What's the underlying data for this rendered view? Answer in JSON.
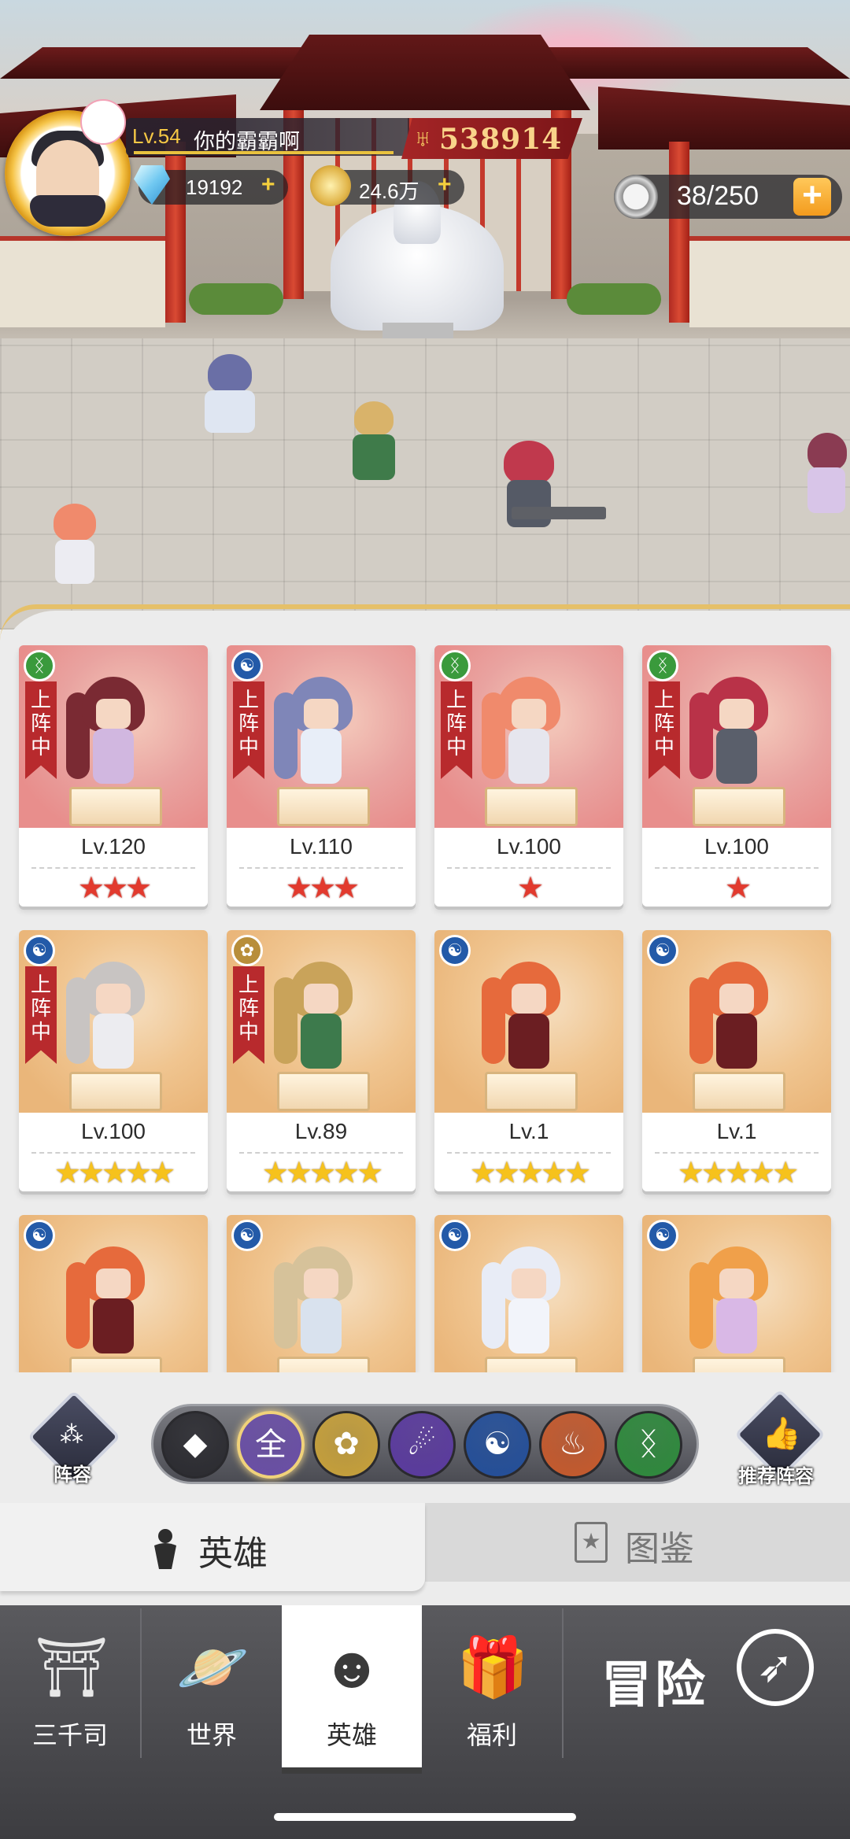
{
  "player": {
    "level": "Lv.54",
    "name": "你的霸霸啊",
    "power": "538914"
  },
  "resources": {
    "gems": "19192",
    "coins": "24.6万",
    "stamina": "38/250",
    "gem_icon": "diamond-icon",
    "coin_icon": "gold-coin-icon",
    "stamina_icon": "stamina-token-icon"
  },
  "deployed_label": "上阵中",
  "heroes": [
    {
      "level": "Lv.120",
      "stars": "★★★",
      "star_count": 3,
      "star_color": "#e23a2e",
      "element": "nature",
      "element_glyph": "DNA",
      "deployed": true,
      "card_color": "red"
    },
    {
      "level": "Lv.110",
      "stars": "★★★",
      "star_count": 3,
      "star_color": "#e23a2e",
      "element": "water",
      "element_glyph": "☯",
      "deployed": true,
      "card_color": "red"
    },
    {
      "level": "Lv.100",
      "stars": "★",
      "star_count": 1,
      "star_color": "#e23a2e",
      "element": "nature",
      "element_glyph": "DNA",
      "deployed": true,
      "card_color": "red"
    },
    {
      "level": "Lv.100",
      "stars": "★",
      "star_count": 1,
      "star_color": "#e23a2e",
      "element": "nature",
      "element_glyph": "DNA",
      "deployed": true,
      "card_color": "red"
    },
    {
      "level": "Lv.100",
      "stars": "★★★★★",
      "star_count": 5,
      "star_color": "#f6c21c",
      "element": "water",
      "element_glyph": "☯",
      "deployed": true,
      "card_color": "orange"
    },
    {
      "level": "Lv.89",
      "stars": "★★★★★",
      "star_count": 5,
      "star_color": "#f6c21c",
      "element": "lotus",
      "element_glyph": "✿",
      "deployed": true,
      "card_color": "orange"
    },
    {
      "level": "Lv.1",
      "stars": "★★★★★",
      "star_count": 5,
      "star_color": "#f6c21c",
      "element": "water",
      "element_glyph": "☯",
      "deployed": false,
      "card_color": "orange"
    },
    {
      "level": "Lv.1",
      "stars": "★★★★★",
      "star_count": 5,
      "star_color": "#f6c21c",
      "element": "water",
      "element_glyph": "☯",
      "deployed": false,
      "card_color": "orange"
    },
    {
      "level": "",
      "stars": "",
      "element": "water",
      "element_glyph": "☯",
      "deployed": false,
      "card_color": "orange"
    },
    {
      "level": "",
      "stars": "",
      "element": "water",
      "element_glyph": "☯",
      "deployed": false,
      "card_color": "orange"
    },
    {
      "level": "",
      "stars": "",
      "element": "water",
      "element_glyph": "☯",
      "deployed": false,
      "card_color": "orange"
    },
    {
      "level": "",
      "stars": "",
      "element": "water",
      "element_glyph": "☯",
      "deployed": false,
      "card_color": "orange"
    }
  ],
  "filter_bar": {
    "lineup_label": "阵容",
    "recommend_label": "推荐阵容",
    "filters": [
      {
        "name": "sort-diamond-icon",
        "glyph": "◆",
        "color": "#2b2b30",
        "selected": false
      },
      {
        "name": "all",
        "glyph": "全",
        "color": "#6b4fa8",
        "selected": true
      },
      {
        "name": "lotus-icon",
        "glyph": "✿",
        "color": "#c9a23a",
        "selected": false
      },
      {
        "name": "fire-icon",
        "glyph": "☄",
        "color": "#5b3aa0",
        "selected": false
      },
      {
        "name": "water-icon",
        "glyph": "☯",
        "color": "#234f9b",
        "selected": false
      },
      {
        "name": "meditation-icon",
        "glyph": "♨",
        "color": "#c85a2c",
        "selected": false
      },
      {
        "name": "nature-icon",
        "glyph": "ᛝ",
        "color": "#2e8b3c",
        "selected": false
      }
    ]
  },
  "tabs": {
    "heroes": "英雄",
    "codex": "图鉴"
  },
  "bottom_nav": {
    "items": [
      {
        "label": "三千司",
        "icon": "temple-icon"
      },
      {
        "label": "世界",
        "icon": "planet-icon"
      },
      {
        "label": "英雄",
        "icon": "hero-icon",
        "active": true
      },
      {
        "label": "福利",
        "icon": "gift-box-icon"
      }
    ],
    "adventure_label": "冒险",
    "adventure_icon": "compass-icon"
  }
}
